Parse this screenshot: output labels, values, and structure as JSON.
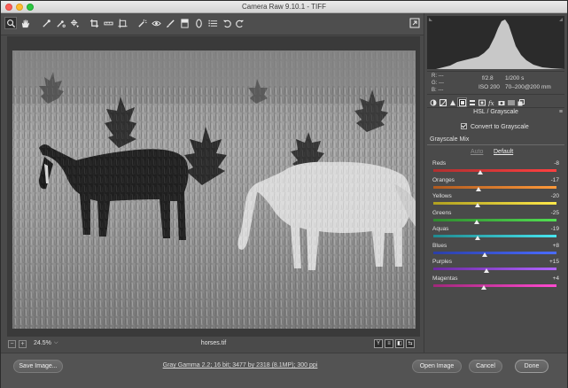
{
  "window": {
    "title": "Camera Raw 9.10.1  -  TIFF"
  },
  "toolbar": {
    "tools": [
      "zoom-tool-icon",
      "hand-tool-icon",
      "white-balance-tool-icon",
      "color-sampler-tool-icon",
      "targeted-adjustment-tool-icon",
      "crop-tool-icon",
      "straighten-tool-icon",
      "transform-tool-icon",
      "spot-removal-tool-icon",
      "red-eye-removal-tool-icon",
      "adjustment-brush-icon",
      "graduated-filter-icon",
      "radial-filter-icon",
      "open-preferences-icon",
      "rotate-left-icon",
      "rotate-right-icon"
    ]
  },
  "preview": {
    "zoom_minus": "−",
    "zoom_plus": "+",
    "zoom_level": "24.5%",
    "zoom_dropdown": "⌵",
    "filename": "horses.tif",
    "view_buttons": [
      "Y",
      "≡",
      "◧",
      "⇆"
    ]
  },
  "histogram": {
    "r_label": "R:",
    "g_label": "G:",
    "b_label": "B:",
    "r": "---",
    "g": "---",
    "b": "---",
    "aperture": "f/2.8",
    "shutter": "1/200 s",
    "iso": "ISO 200",
    "lens": "70–200@200 mm"
  },
  "panel": {
    "title": "HSL / Grayscale",
    "menu_icon": "≡",
    "convert_label": "Convert to Grayscale",
    "mix_label": "Grayscale Mix",
    "auto_label": "Auto",
    "default_label": "Default",
    "sliders": [
      {
        "label": "Reds",
        "value": "-8",
        "num": -8,
        "grad": [
          "#b03030",
          "#ff4040"
        ]
      },
      {
        "label": "Oranges",
        "value": "-17",
        "num": -17,
        "grad": [
          "#b05a20",
          "#ff9a3a"
        ]
      },
      {
        "label": "Yellows",
        "value": "-20",
        "num": -20,
        "grad": [
          "#b0a020",
          "#ffe84a"
        ]
      },
      {
        "label": "Greens",
        "value": "-25",
        "num": -25,
        "grad": [
          "#2f8a2f",
          "#52e052"
        ]
      },
      {
        "label": "Aquas",
        "value": "-19",
        "num": -19,
        "grad": [
          "#208a90",
          "#48e6f0"
        ]
      },
      {
        "label": "Blues",
        "value": "+8",
        "num": 8,
        "grad": [
          "#2b3fa8",
          "#4a6cff"
        ]
      },
      {
        "label": "Purples",
        "value": "+15",
        "num": 15,
        "grad": [
          "#6d2aa3",
          "#b064ff"
        ]
      },
      {
        "label": "Magentas",
        "value": "+4",
        "num": 4,
        "grad": [
          "#a0287a",
          "#ff4ad0"
        ]
      }
    ]
  },
  "footer": {
    "save_label": "Save Image...",
    "workflow_label": "Gray Gamma 2.2; 16 bit; 3477 by 2318 (8.1MP); 300 ppi",
    "open_label": "Open Image",
    "cancel_label": "Cancel",
    "done_label": "Done"
  }
}
